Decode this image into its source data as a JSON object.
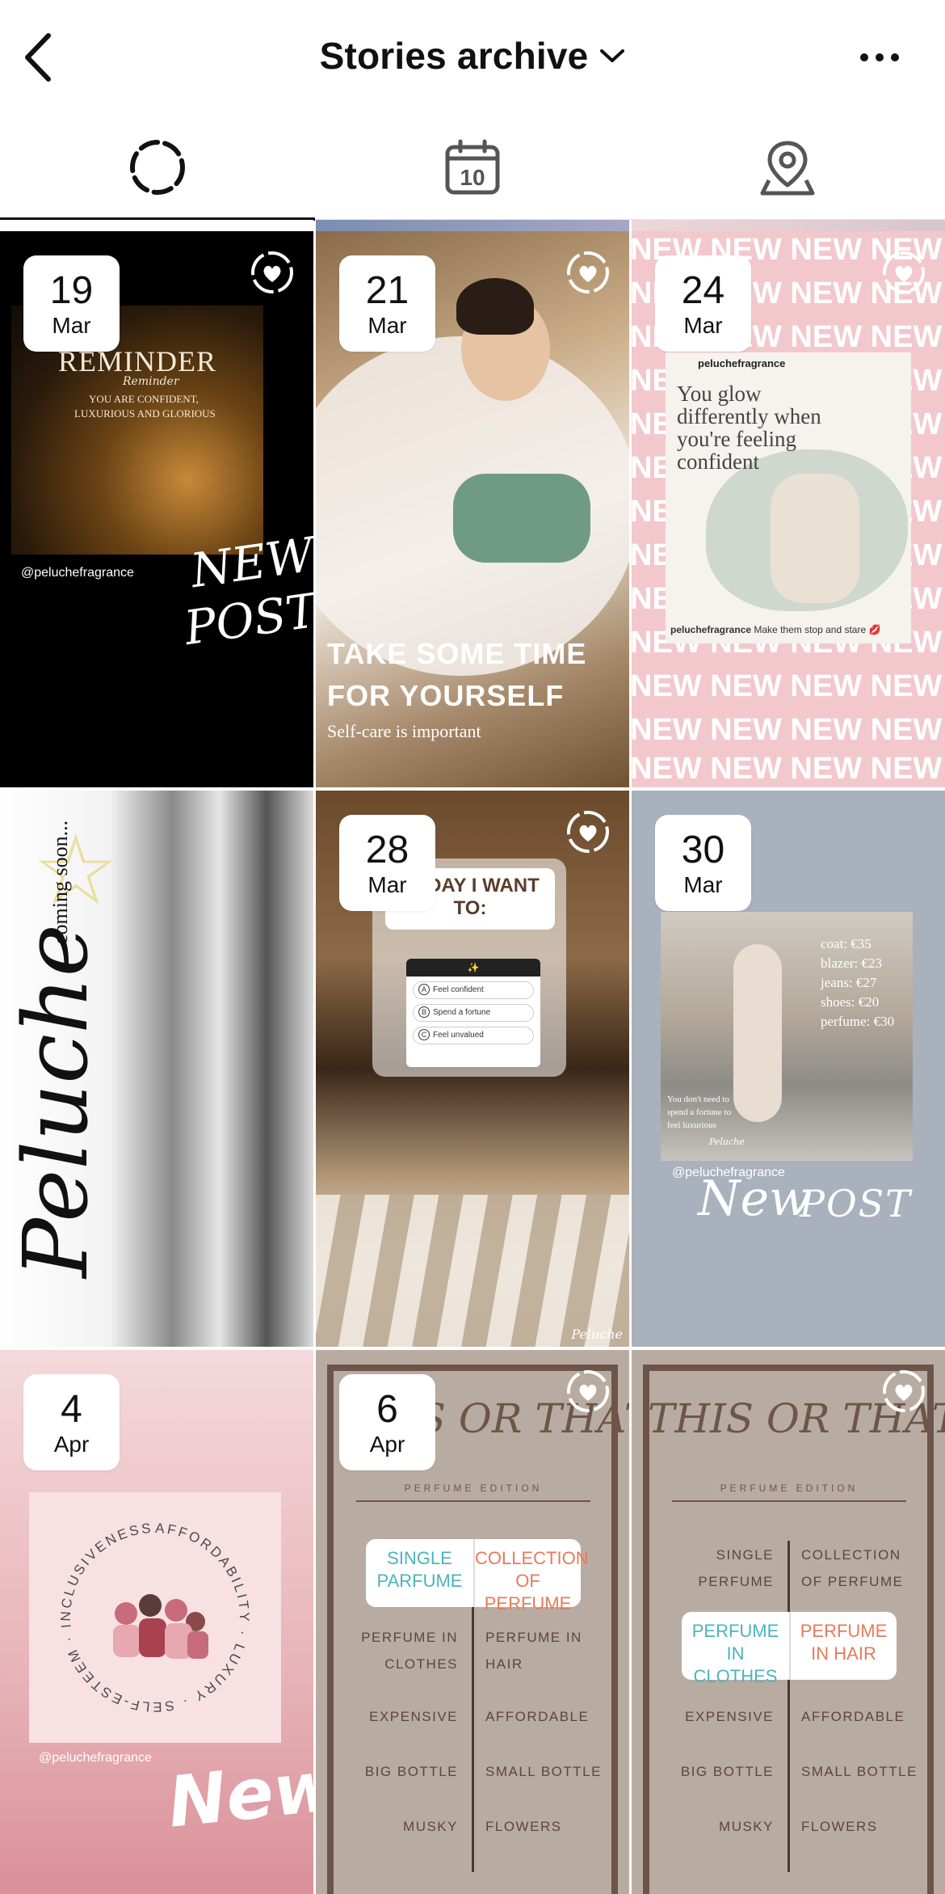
{
  "header": {
    "title": "Stories archive",
    "back_icon": "chevron-left-icon",
    "title_chevron_icon": "chevron-down-icon",
    "more_icon": "more-horizontal-icon"
  },
  "tabs": [
    {
      "name": "stories",
      "icon": "dashed-circle-icon",
      "active": true
    },
    {
      "name": "calendar",
      "icon": "calendar-icon",
      "calendar_day": "10",
      "active": false
    },
    {
      "name": "location",
      "icon": "map-pin-icon",
      "active": false
    }
  ],
  "stories": [
    {
      "day": "19",
      "month": "Mar",
      "theme": "black",
      "text": {
        "reminder": "REMINDER",
        "reminder_script": "Reminder",
        "line1": "YOU ARE CONFIDENT,",
        "line2": "LUXURIOUS AND GLORIOUS",
        "handle": "@peluchefragrance",
        "new": "NEW",
        "post": "POST"
      }
    },
    {
      "day": "21",
      "month": "Mar",
      "theme": "bath",
      "text": {
        "line1": "TAKE SOME TIME",
        "line2": "FOR YOURSELF",
        "sub": "Self-care is important"
      }
    },
    {
      "day": "24",
      "month": "Mar",
      "theme": "pink-new",
      "text": {
        "bg_word": "NEW NEW NEW NEW",
        "card_user": "peluchefragrance",
        "quote1": "You glow",
        "quote2": "differently when",
        "quote3": "you're feeling",
        "quote4": "confident",
        "caption_user": "peluchefragrance",
        "caption": "Make them stop and stare 💋"
      }
    },
    {
      "theme": "peluche",
      "text": {
        "brand": "Peluche",
        "coming": "coming soon..."
      }
    },
    {
      "day": "28",
      "month": "Mar",
      "theme": "hall",
      "text": {
        "question1": "TODAY I WANT",
        "question2": "TO:",
        "opt_a": "Feel confident",
        "opt_b": "Spend a fortune",
        "opt_c": "Feel unvalued",
        "letter_a": "A",
        "letter_b": "B",
        "letter_c": "C",
        "poll_icon": "✨",
        "signature": "Peluche"
      }
    },
    {
      "day": "30",
      "month": "Mar",
      "theme": "street",
      "text": {
        "coat": "coat: €35",
        "blazer": "blazer: €23",
        "jeans": "jeans: €27",
        "shoes": "shoes: €20",
        "perfume": "perfume: €30",
        "note1": "You don't need to",
        "note2": "spend a fortune to",
        "note3": "feel luxurious",
        "note_sign": "Peluche",
        "handle": "@peluchefragrance",
        "new": "New",
        "post": "POST"
      }
    },
    {
      "day": "4",
      "month": "Apr",
      "theme": "pink-circle",
      "text": {
        "ring": "AFFORDABILITY · LUXURY · SELF-ESTEEM · INCLUSIVENESS ·",
        "handle": "@peluchefragrance",
        "new": "New"
      }
    },
    {
      "day": "6",
      "month": "Apr",
      "theme": "this-or-that-1",
      "text": {
        "title": "THIS OR THAT",
        "edition": "PERFUME EDITION",
        "a1": "SINGLE",
        "a2": "PARFUME",
        "b1": "COLLECTION",
        "b2": "OF PERFUME",
        "c1": "PERFUME IN",
        "c2": "CLOTHES",
        "d1": "PERFUME IN",
        "d2": "HAIR",
        "e": "EXPENSIVE",
        "f": "AFFORDABLE",
        "g": "BIG BOTTLE",
        "h": "SMALL BOTTLE",
        "i": "MUSKY",
        "j": "FLOWERS"
      }
    },
    {
      "theme": "this-or-that-2",
      "text": {
        "title": "THIS OR THAT",
        "edition": "PERFUME EDITION",
        "a1": "SINGLE",
        "a2": "PERFUME",
        "b1": "COLLECTION",
        "b2": "OF PERFUME",
        "c1": "PERFUME IN",
        "c2": "CLOTHES",
        "d1": "PERFUME",
        "d2": "IN HAIR",
        "e": "EXPENSIVE",
        "f": "AFFORDABLE",
        "g": "BIG BOTTLE",
        "h": "SMALL BOTTLE",
        "i": "MUSKY",
        "j": "FLOWERS"
      }
    }
  ],
  "colors": {
    "accent": "#111111",
    "pink": "#f2c8cd",
    "taupe": "#b8aca2",
    "brown": "#6e5549"
  }
}
